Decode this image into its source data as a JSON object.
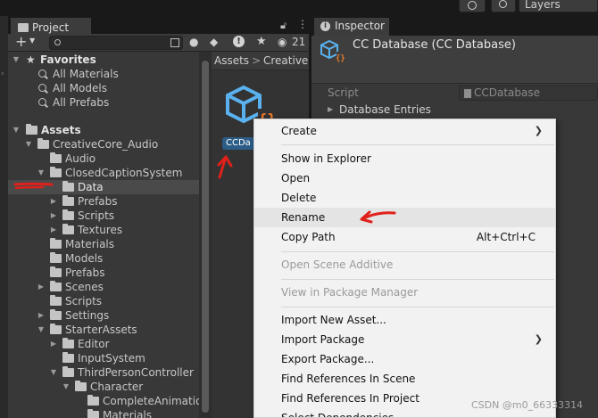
{
  "project_panel": {
    "tab_label": "Project",
    "search_placeholder": "",
    "hidden_count": "21",
    "favorites": {
      "label": "Favorites",
      "items": [
        "All Materials",
        "All Models",
        "All Prefabs"
      ]
    },
    "tree": [
      {
        "label": "Assets",
        "bold": true
      },
      {
        "label": "CreativeCore_Audio"
      },
      {
        "label": "Audio"
      },
      {
        "label": "ClosedCaptionSystem"
      },
      {
        "label": "Data",
        "selected": true
      },
      {
        "label": "Prefabs"
      },
      {
        "label": "Scripts"
      },
      {
        "label": "Textures"
      },
      {
        "label": "Materials"
      },
      {
        "label": "Models"
      },
      {
        "label": "Prefabs"
      },
      {
        "label": "Scenes"
      },
      {
        "label": "Scripts"
      },
      {
        "label": "Settings"
      },
      {
        "label": "StarterAssets"
      },
      {
        "label": "Editor"
      },
      {
        "label": "InputSystem"
      },
      {
        "label": "ThirdPersonController"
      },
      {
        "label": "Character"
      },
      {
        "label": "CompleteAnimation"
      },
      {
        "label": "Materials"
      }
    ],
    "breadcrumb": [
      "Assets",
      "CreativeC"
    ],
    "asset_label": "CCDa"
  },
  "top_bar": {
    "layers_label": "Layers"
  },
  "inspector": {
    "tab_label": "Inspector",
    "title": "CC Database (CC Database)",
    "script_label": "Script",
    "script_value": "CCDatabase",
    "foldout_label": "Database Entries"
  },
  "context_menu": {
    "items": [
      {
        "label": "Create",
        "submenu": true
      },
      {
        "separator": true
      },
      {
        "label": "Show in Explorer"
      },
      {
        "label": "Open"
      },
      {
        "label": "Delete"
      },
      {
        "label": "Rename",
        "highlighted": true
      },
      {
        "label": "Copy Path",
        "shortcut": "Alt+Ctrl+C"
      },
      {
        "separator": true
      },
      {
        "label": "Open Scene Additive",
        "disabled": true
      },
      {
        "separator": true
      },
      {
        "label": "View in Package Manager",
        "disabled": true
      },
      {
        "separator": true
      },
      {
        "label": "Import New Asset..."
      },
      {
        "label": "Import Package",
        "submenu": true
      },
      {
        "label": "Export Package..."
      },
      {
        "label": "Find References In Scene"
      },
      {
        "label": "Find References In Project"
      },
      {
        "label": "Select Dependencies"
      }
    ]
  },
  "watermark": "CSDN @m0_66333314",
  "colors": {
    "annotation_red": "#e0201b",
    "asset_icon_blue": "#5ab1ef",
    "asset_icon_orange": "#f07d2a",
    "selection_label": "#2c5d87"
  }
}
